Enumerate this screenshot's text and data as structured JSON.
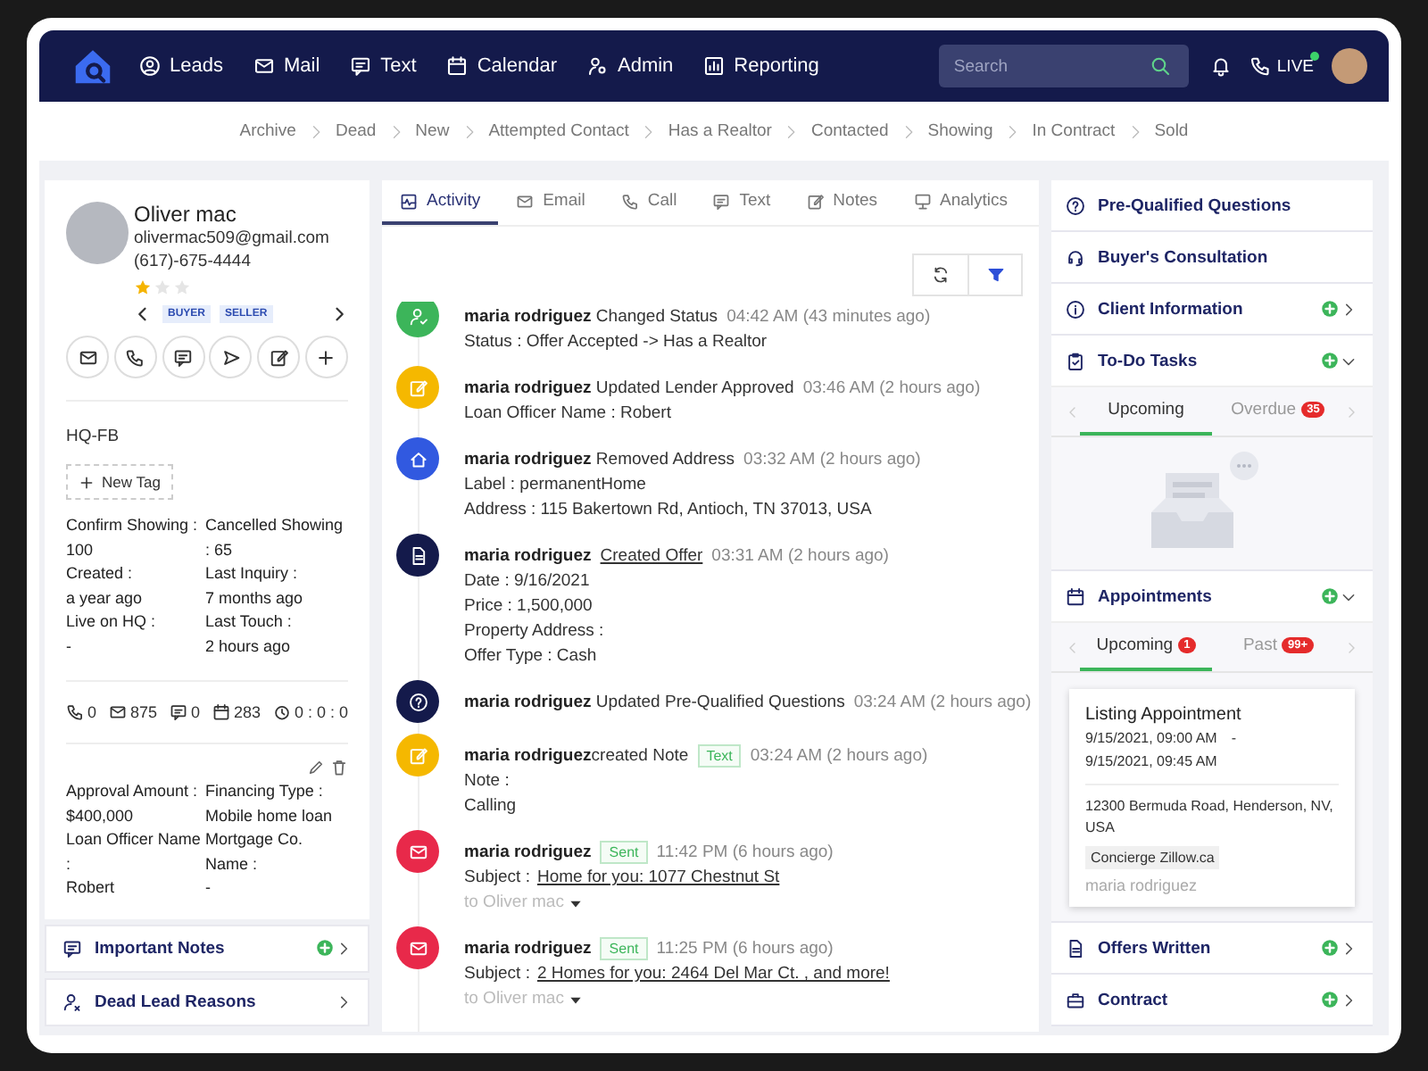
{
  "nav": {
    "items": [
      {
        "label": "Leads"
      },
      {
        "label": "Mail"
      },
      {
        "label": "Text"
      },
      {
        "label": "Calendar"
      },
      {
        "label": "Admin"
      },
      {
        "label": "Reporting"
      }
    ],
    "search": {
      "placeholder": "Search"
    },
    "live": "LIVE"
  },
  "pipeline": [
    "Archive",
    "Dead",
    "New",
    "Attempted Contact",
    "Has a Realtor",
    "Contacted",
    "Showing",
    "In Contract",
    "Sold"
  ],
  "contact": {
    "name": "Oliver mac",
    "email": "olivermac509@gmail.com",
    "phone": "(617)-675-4444",
    "stars": 1,
    "tags": [
      "BUYER",
      "SELLER"
    ],
    "source": "HQ-FB",
    "new_tag": "New Tag",
    "fields": [
      {
        "label": "Confirm Showing :",
        "value": "100"
      },
      {
        "label": "Cancelled Showing",
        "value": ": 65"
      },
      {
        "label": "Created :",
        "value": "a year ago"
      },
      {
        "label": "Last Inquiry :",
        "value": "7 months ago"
      },
      {
        "label": "Live on HQ :",
        "value": "-"
      },
      {
        "label": "Last Touch :",
        "value": "2 hours ago"
      }
    ],
    "counters": [
      "0",
      "875",
      "0",
      "283",
      "0 : 0 : 0"
    ],
    "lender_fields": [
      {
        "label": "Approval Amount :",
        "value": "$400,000"
      },
      {
        "label": "Financing Type :",
        "value": "Mobile home loan"
      },
      {
        "label": "Loan Officer Name :",
        "value": "Robert"
      },
      {
        "label": "Mortgage Co. Name :",
        "value": "-"
      }
    ]
  },
  "left_sections": [
    {
      "title": "Important Notes",
      "add": true
    },
    {
      "title": "Dead Lead Reasons",
      "add": false
    }
  ],
  "tabs": [
    {
      "label": "Activity",
      "selected": true
    },
    {
      "label": "Email",
      "selected": false
    },
    {
      "label": "Call",
      "selected": false
    },
    {
      "label": "Text",
      "selected": false
    },
    {
      "label": "Notes",
      "selected": false
    },
    {
      "label": "Analytics",
      "selected": false
    }
  ],
  "activities": [
    {
      "kind": "status",
      "color": "#3cb55a",
      "title": "**maria rodriguez** Changed Status",
      "time": "04:42 AM (43 minutes ago)",
      "lines": [
        "Status : Offer Accepted -> Has a Realtor"
      ]
    },
    {
      "kind": "lender",
      "color": "#f5b800",
      "title": "**maria rodriguez** Updated Lender Approved",
      "time": "03:46 AM (2 hours ago)",
      "lines": [
        "Loan Officer Name : Robert"
      ]
    },
    {
      "kind": "address",
      "color": "#3159e0",
      "title": "**maria rodriguez** Removed Address",
      "time": "03:32 AM (2 hours ago)",
      "lines": [
        "Label : permanentHome",
        "Address : 115 Bakertown Rd, Antioch, TN 37013, USA"
      ]
    },
    {
      "kind": "offer",
      "color": "#141a4b",
      "title": "**maria rodriguez**",
      "link": "Created Offer",
      "time": "03:31 AM (2 hours ago)",
      "lines": [
        "Date : 9/16/2021",
        "Price : 1,500,000",
        "Property Address :",
        "Offer Type : Cash"
      ]
    },
    {
      "kind": "questions",
      "color": "#141a4b",
      "title": "**maria rodriguez** Updated Pre-Qualified Questions",
      "time": "03:24 AM (2 hours ago)"
    },
    {
      "kind": "note",
      "color": "#f5b800",
      "title": "**maria rodriguez**created Note",
      "badge": "Text",
      "time": "03:24 AM (2 hours ago)",
      "lines": [
        "Note :",
        "Calling"
      ]
    },
    {
      "kind": "email",
      "color": "#e8294a",
      "title": "**maria rodriguez**",
      "badge": "Sent",
      "time": "11:42 PM (6 hours ago)",
      "subject_label": "Subject :",
      "subject": "Home for you: 1077 Chestnut St",
      "recipient": "to Oliver mac"
    },
    {
      "kind": "email",
      "color": "#e8294a",
      "title": "**maria rodriguez**",
      "badge": "Sent",
      "time": "11:25 PM (6 hours ago)",
      "subject_label": "Subject :",
      "subject": "2 Homes for you: 2464 Del Mar Ct. , and more!",
      "recipient": "to Oliver mac"
    }
  ],
  "right_sections": [
    {
      "title": "Pre-Qualified Questions",
      "add": false
    },
    {
      "title": "Buyer's Consultation",
      "add": false
    },
    {
      "title": "Client Information",
      "add": true,
      "expanded": false
    },
    {
      "title": "To-Do Tasks",
      "add": true,
      "expanded": true,
      "tabs": [
        {
          "label": "Upcoming",
          "selected": true
        },
        {
          "label": "Overdue",
          "count": "35",
          "selected": false
        }
      ],
      "empty": true
    },
    {
      "title": "Appointments",
      "add": true,
      "expanded": true,
      "tabs": [
        {
          "label": "Upcoming",
          "count": "1",
          "selected": true
        },
        {
          "label": "Past",
          "count": "99+",
          "selected": false
        }
      ],
      "appointments": [
        {
          "title": "Listing Appointment",
          "start": "9/15/2021, 09:00 AM",
          "separator": "-",
          "end": "9/15/2021, 09:45 AM",
          "address": "12300 Bermuda Road, Henderson, NV, USA",
          "tag": "Concierge Zillow.ca",
          "agent": "maria rodriguez"
        }
      ]
    },
    {
      "title": "Offers Written",
      "add": true,
      "expanded": false
    },
    {
      "title": "Contract",
      "add": true,
      "expanded": false
    }
  ]
}
